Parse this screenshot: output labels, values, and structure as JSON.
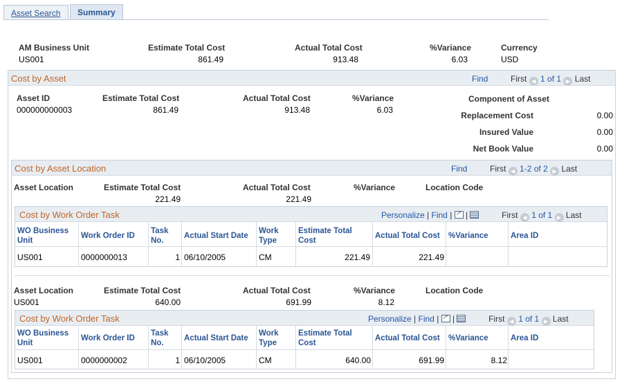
{
  "tabs": [
    {
      "label": "Asset Search"
    },
    {
      "label": "Summary"
    }
  ],
  "header": {
    "labels": {
      "business_unit": "AM Business Unit",
      "estimate_total_cost": "Estimate Total Cost",
      "actual_total_cost": "Actual Total Cost",
      "variance": "%Variance",
      "currency": "Currency"
    },
    "values": {
      "business_unit": "US001",
      "estimate_total_cost": "861.49",
      "actual_total_cost": "913.48",
      "variance": "6.03",
      "currency": "USD"
    }
  },
  "cost_by_asset": {
    "title": "Cost by Asset",
    "nav": {
      "find": "Find",
      "first": "First",
      "range": "1 of 1",
      "last": "Last"
    },
    "labels": {
      "asset_id": "Asset ID",
      "estimate_total_cost": "Estimate Total Cost",
      "actual_total_cost": "Actual Total Cost",
      "variance": "%Variance",
      "component": "Component of Asset",
      "replacement_cost": "Replacement Cost",
      "insured_value": "Insured Value",
      "net_book_value": "Net Book Value"
    },
    "values": {
      "asset_id": "000000000003",
      "estimate_total_cost": "861.49",
      "actual_total_cost": "913.48",
      "variance": "6.03",
      "replacement_cost": "0.00",
      "insured_value": "0.00",
      "net_book_value": "0.00"
    }
  },
  "cost_by_location": {
    "title": "Cost by Asset Location",
    "nav": {
      "find": "Find",
      "first": "First",
      "range": "1-2 of 2",
      "last": "Last"
    },
    "labels": {
      "asset_location": "Asset Location",
      "estimate_total_cost": "Estimate Total Cost",
      "actual_total_cost": "Actual Total Cost",
      "variance": "%Variance",
      "location_code": "Location Code"
    },
    "locations": [
      {
        "asset_location": "",
        "estimate_total_cost": "221.49",
        "actual_total_cost": "221.49",
        "variance": "",
        "location_code": ""
      },
      {
        "asset_location": "US001",
        "estimate_total_cost": "640.00",
        "actual_total_cost": "691.99",
        "variance": "8.12",
        "location_code": ""
      }
    ]
  },
  "work_order_task": {
    "title": "Cost by Work Order Task",
    "nav": {
      "personalize": "Personalize",
      "sep": "|",
      "find": "Find",
      "first": "First",
      "range": "1 of 1",
      "last": "Last"
    },
    "columns": {
      "wo_bu_1": "WO Business",
      "wo_bu_2": "Unit",
      "wo_id": "Work Order ID",
      "task_1": "Task",
      "task_2": "No.",
      "start": "Actual Start Date",
      "type_1": "Work",
      "type_2": "Type",
      "est_1": "Estimate Total",
      "est_2": "Cost",
      "actual": "Actual Total Cost",
      "variance": "%Variance",
      "area": "Area ID"
    },
    "rows": [
      {
        "wo_bu": "US001",
        "wo_id": "0000000013",
        "task": "1",
        "start": "06/10/2005",
        "type": "CM",
        "est": "221.49",
        "actual": "221.49",
        "variance": "",
        "area": ""
      },
      {
        "wo_bu": "US001",
        "wo_id": "0000000002",
        "task": "1",
        "start": "06/10/2005",
        "type": "CM",
        "est": "640.00",
        "actual": "691.99",
        "variance": "8.12",
        "area": ""
      }
    ]
  },
  "colors": {
    "accent_title": "#c0662a",
    "link": "#2255a4",
    "panel_bg": "#e8edf2"
  }
}
